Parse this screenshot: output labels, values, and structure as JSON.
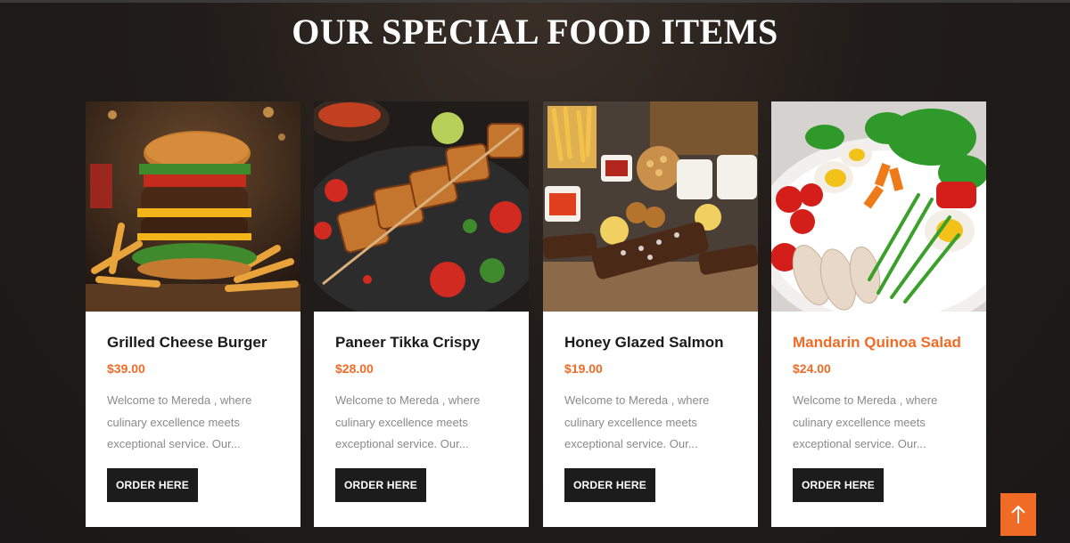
{
  "section": {
    "title": "OUR SPECIAL FOOD ITEMS"
  },
  "items": [
    {
      "title": "Grilled Cheese Burger",
      "price": "$39.00",
      "description": "Welcome to Mereda , where culinary excellence meets exceptional service. Our...",
      "button_label": "ORDER HERE",
      "image_icon": "burger-image"
    },
    {
      "title": "Paneer Tikka Crispy",
      "price": "$28.00",
      "description": "Welcome to Mereda , where culinary excellence meets exceptional service. Our...",
      "button_label": "ORDER HERE",
      "image_icon": "paneer-tikka-image"
    },
    {
      "title": "Honey Glazed Salmon",
      "price": "$19.00",
      "description": "Welcome to Mereda , where culinary excellence meets exceptional service. Our...",
      "button_label": "ORDER HERE",
      "image_icon": "salmon-platter-image"
    },
    {
      "title": "Mandarin Quinoa Salad",
      "price": "$24.00",
      "description": "Welcome to Mereda , where culinary excellence meets exceptional service. Our...",
      "button_label": "ORDER HERE",
      "image_icon": "salad-image",
      "highlighted": true
    }
  ],
  "scroll_top": {
    "icon": "arrow-up-icon"
  },
  "colors": {
    "accent": "#f06b25",
    "button": "#1c1c1c",
    "card": "#ffffff"
  }
}
